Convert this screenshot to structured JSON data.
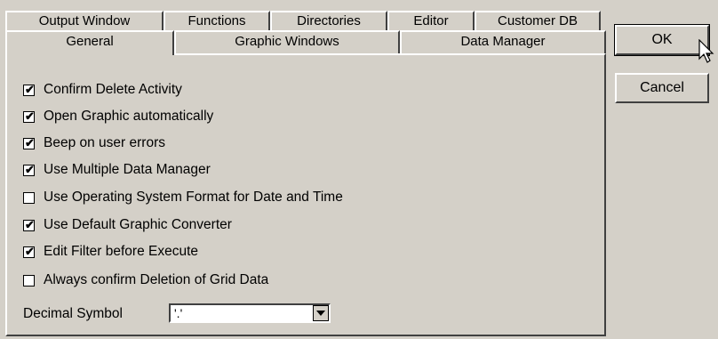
{
  "tabs": {
    "back_row": [
      {
        "label": "Output Window"
      },
      {
        "label": "Functions"
      },
      {
        "label": "Directories"
      },
      {
        "label": "Editor"
      },
      {
        "label": "Customer DB"
      }
    ],
    "front_row": [
      {
        "label": "General",
        "selected": true
      },
      {
        "label": "Graphic Windows"
      },
      {
        "label": "Data Manager"
      }
    ]
  },
  "options": [
    {
      "label": "Confirm Delete Activity",
      "checked": true
    },
    {
      "label": "Open Graphic automatically",
      "checked": true
    },
    {
      "label": "Beep on user errors",
      "checked": true
    },
    {
      "label": "Use Multiple Data Manager",
      "checked": true
    },
    {
      "label": "Use Operating System Format for Date and Time",
      "checked": false
    },
    {
      "label": "Use Default Graphic Converter",
      "checked": true
    },
    {
      "label": "Edit Filter before Execute",
      "checked": true
    },
    {
      "label": "Always confirm Deletion of Grid Data",
      "checked": false
    }
  ],
  "decimal": {
    "label": "Decimal Symbol",
    "value": "'.'"
  },
  "buttons": {
    "ok": "OK",
    "cancel": "Cancel"
  },
  "check_glyph": "✔"
}
